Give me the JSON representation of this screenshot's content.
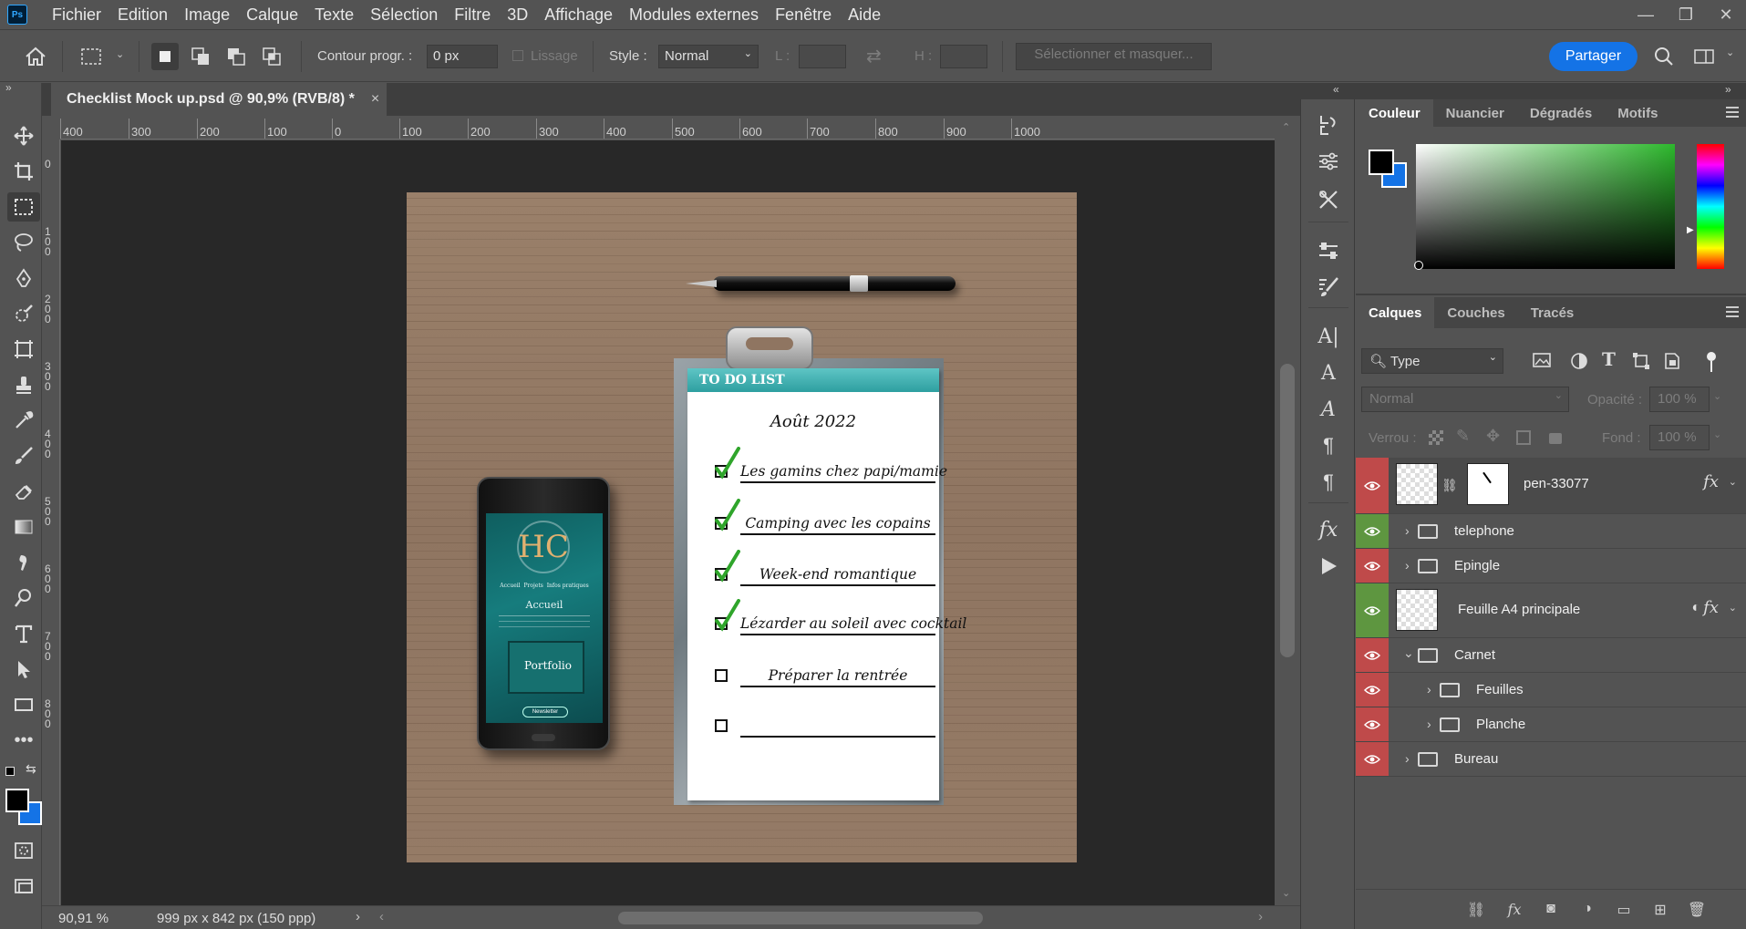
{
  "app": {
    "logo_text": "Ps"
  },
  "menu": {
    "items": [
      "Fichier",
      "Edition",
      "Image",
      "Calque",
      "Texte",
      "Sélection",
      "Filtre",
      "3D",
      "Affichage",
      "Modules externes",
      "Fenêtre",
      "Aide"
    ]
  },
  "window_controls": {
    "minimize": "—",
    "restore": "❐",
    "close": "✕"
  },
  "options": {
    "feather_label": "Contour progr. :",
    "feather_value": "0 px",
    "antialias_label": "Lissage",
    "style_label": "Style :",
    "style_value": "Normal",
    "width_label": "L :",
    "height_label": "H :",
    "select_mask": "Sélectionner et masquer...",
    "share": "Partager"
  },
  "document": {
    "tab_title": "Checklist Mock up.psd @ 90,9% (RVB/8) *",
    "close": "×",
    "zoom": "90,91 %",
    "doc_size": "999 px x 842 px (150 ppp)"
  },
  "ruler": {
    "h_labels": [
      "400",
      "300",
      "200",
      "100",
      "0",
      "100",
      "200",
      "300",
      "400",
      "500",
      "600",
      "700",
      "800",
      "900",
      "1000"
    ],
    "v_labels": [
      "0",
      "100",
      "200",
      "300",
      "400",
      "500",
      "600",
      "700",
      "800"
    ]
  },
  "mockup": {
    "todo_title": "TO DO LIST",
    "date": "Août 2022",
    "tasks": [
      {
        "label": "Les gamins chez papi/mamie",
        "checked": true
      },
      {
        "label": "Camping avec les copains",
        "checked": true
      },
      {
        "label": "Week-end romantique",
        "checked": true
      },
      {
        "label": "Lézarder au soleil avec cocktail",
        "checked": true
      },
      {
        "label": "Préparer la rentrée",
        "checked": false
      },
      {
        "label": "",
        "checked": false
      }
    ],
    "phone": {
      "nav": [
        "Accueil",
        "Projets",
        "Infos pratiques"
      ],
      "heading": "Accueil",
      "image_text": "Portfolio",
      "button": "Newsletter"
    }
  },
  "color_panel": {
    "tabs": [
      "Couleur",
      "Nuancier",
      "Dégradés",
      "Motifs"
    ],
    "active_tab": "Couleur",
    "foreground": "#000000",
    "background": "#1473e6"
  },
  "layers_panel": {
    "tabs": [
      "Calques",
      "Couches",
      "Tracés"
    ],
    "active_tab": "Calques",
    "filter_value": "Type",
    "blend_mode": "Normal",
    "opacity_label": "Opacité :",
    "opacity_value": "100 %",
    "lock_label": "Verrou :",
    "fill_label": "Fond :",
    "fill_value": "100 %",
    "layers": [
      {
        "name": "pen-33077",
        "kind": "smart",
        "fx": "fx",
        "color": "red"
      },
      {
        "name": "telephone",
        "kind": "group",
        "color": "green"
      },
      {
        "name": "Epingle",
        "kind": "group",
        "color": "red"
      },
      {
        "name": "Feuille A4 principale",
        "kind": "smart",
        "fx": "fx",
        "color": "green"
      },
      {
        "name": "Carnet",
        "kind": "group-open",
        "color": "red"
      },
      {
        "name": "Feuilles",
        "kind": "subgroup",
        "color": "red"
      },
      {
        "name": "Planche",
        "kind": "subgroup",
        "color": "red"
      },
      {
        "name": "Bureau",
        "kind": "group",
        "color": "red"
      }
    ]
  },
  "accent_color": "#1473e6"
}
